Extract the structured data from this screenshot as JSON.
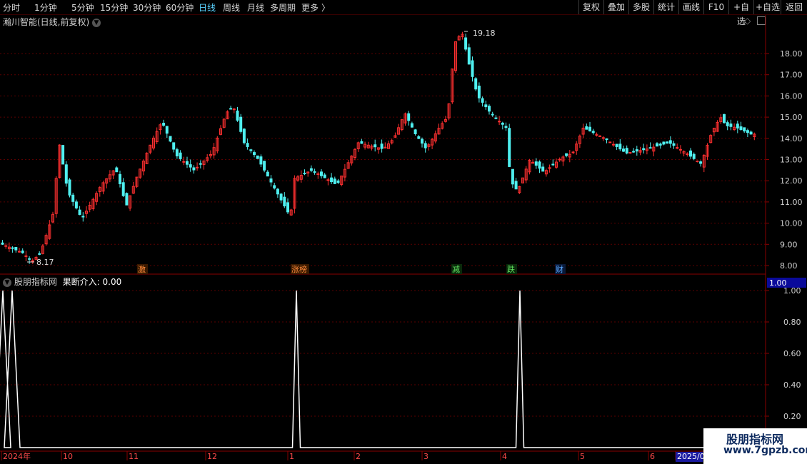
{
  "toolbar": {
    "periods": [
      "分时",
      "1分钟",
      "5分钟",
      "15分钟",
      "30分钟",
      "60分钟",
      "日线",
      "周线",
      "月线",
      "多周期",
      "更多"
    ],
    "active_period": "日线",
    "more_arrow": "〉",
    "right_buttons": [
      "复权",
      "叠加",
      "多股",
      "统计",
      "画线",
      "F10",
      "+自选",
      "返回"
    ]
  },
  "main_chart": {
    "title": "瀚川智能(日线,前复权)",
    "y_ticks": [
      "18.00",
      "17.00",
      "16.00",
      "15.00",
      "14.00",
      "13.00",
      "12.00",
      "11.00",
      "10.00",
      "9.00",
      "8.00"
    ],
    "high_label": "19.18",
    "low_label": "8.17",
    "event_tags": [
      {
        "text": "激",
        "color": "#ff8a3a"
      },
      {
        "text": "涨榜",
        "color": "#ff8a3a"
      },
      {
        "text": "减",
        "color": "#5fe05f"
      },
      {
        "text": "跌",
        "color": "#5fe05f"
      },
      {
        "text": "财",
        "color": "#5aa8ff"
      }
    ],
    "up_color": "#ff3030",
    "down_color": "#4ff0f0"
  },
  "indicator": {
    "title": "股朋指标网",
    "series_label": "果断介入: 0.00",
    "current_value": "1.00",
    "y_ticks": [
      "1.00",
      "0.80",
      "0.60",
      "0.40",
      "0.20"
    ],
    "line_color": "#ffffff"
  },
  "x_axis": {
    "labels": [
      "2024年",
      "10",
      "11",
      "12",
      "1",
      "2",
      "3",
      "4",
      "5",
      "6",
      "2025/0"
    ]
  },
  "watermark": {
    "line1": "股朋指标网",
    "line2": "www.7gpzb.com"
  }
}
